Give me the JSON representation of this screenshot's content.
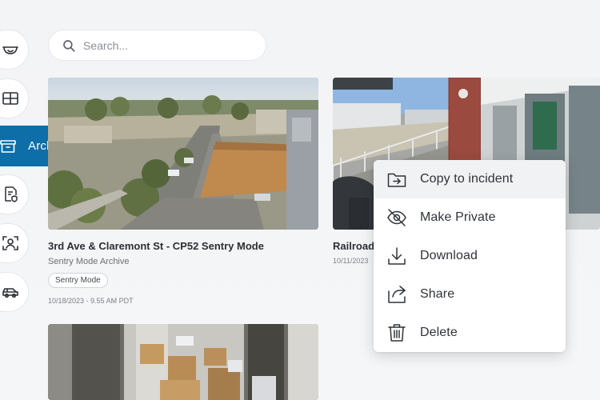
{
  "sidebar": {
    "items": [
      {
        "name": "cameras",
        "label": ""
      },
      {
        "name": "layouts",
        "label": ""
      },
      {
        "name": "archives",
        "label": "Archives"
      },
      {
        "name": "reports",
        "label": ""
      },
      {
        "name": "people",
        "label": ""
      },
      {
        "name": "vehicles",
        "label": ""
      }
    ],
    "active": "archives"
  },
  "search": {
    "placeholder": "Search...",
    "value": ""
  },
  "cards": [
    {
      "title": "3rd Ave & Claremont St - CP52 Sentry Mode",
      "subtitle": "Sentry Mode Archive",
      "tag": "Sentry Mode",
      "date": "10/18/2023 - 9.55 AM PDT"
    },
    {
      "title": "Railroad",
      "date": "10/11/2023"
    },
    {
      "title": "",
      "date": ""
    }
  ],
  "context_menu": {
    "items": [
      {
        "label": "Copy to incident",
        "icon": "copy-to-incident-icon",
        "hovered": true
      },
      {
        "label": "Make Private",
        "icon": "eye-off-icon"
      },
      {
        "label": "Download",
        "icon": "download-icon"
      },
      {
        "label": "Share",
        "icon": "share-icon"
      },
      {
        "label": "Delete",
        "icon": "trash-icon"
      }
    ]
  },
  "colors": {
    "accent": "#0d6ea8",
    "background": "#f3f4f6",
    "text": "#2b2f36",
    "muted": "#6a6f78"
  }
}
